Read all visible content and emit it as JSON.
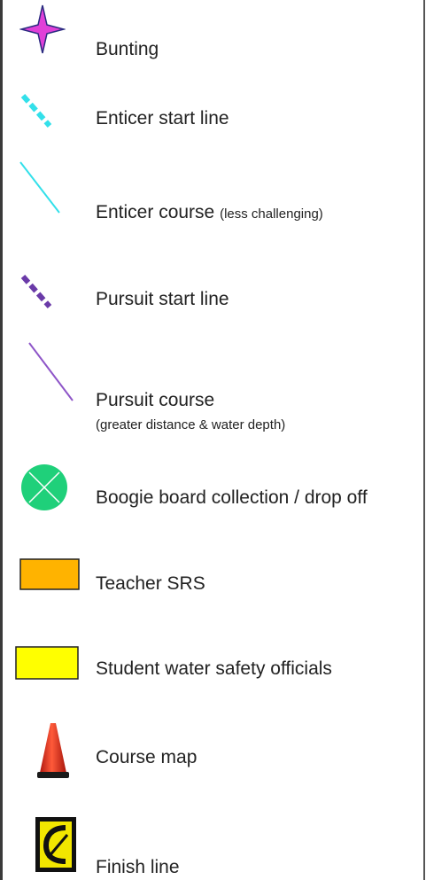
{
  "legend": {
    "items": [
      {
        "label": "Bunting",
        "icon": "bunting-star-icon",
        "color": "#d63bd6"
      },
      {
        "label": "Enticer start line",
        "icon": "enticer-start-line-icon",
        "color": "#33e0ea"
      },
      {
        "label": "Enticer course",
        "note": "(less challenging)",
        "icon": "enticer-course-icon",
        "color": "#33e0ea"
      },
      {
        "label": "Pursuit start line",
        "icon": "pursuit-start-line-icon",
        "color": "#6a3aa8"
      },
      {
        "label": "Pursuit course",
        "note": "(greater distance & water depth)",
        "icon": "pursuit-course-icon",
        "color": "#8e55c8"
      },
      {
        "label": "Boogie board collection / drop off",
        "icon": "boogie-board-icon",
        "color": "#1fd07a"
      },
      {
        "label": "Teacher SRS",
        "icon": "teacher-srs-rect-icon",
        "color": "#ffb300"
      },
      {
        "label": "Student water safety officials",
        "icon": "student-officials-rect-icon",
        "color": "#ffff00"
      },
      {
        "label": "Course map",
        "icon": "traffic-cone-icon",
        "color": "#e8321e"
      },
      {
        "label": "Finish line",
        "icon": "finish-line-sign-icon",
        "color": "#f2e600"
      }
    ]
  }
}
